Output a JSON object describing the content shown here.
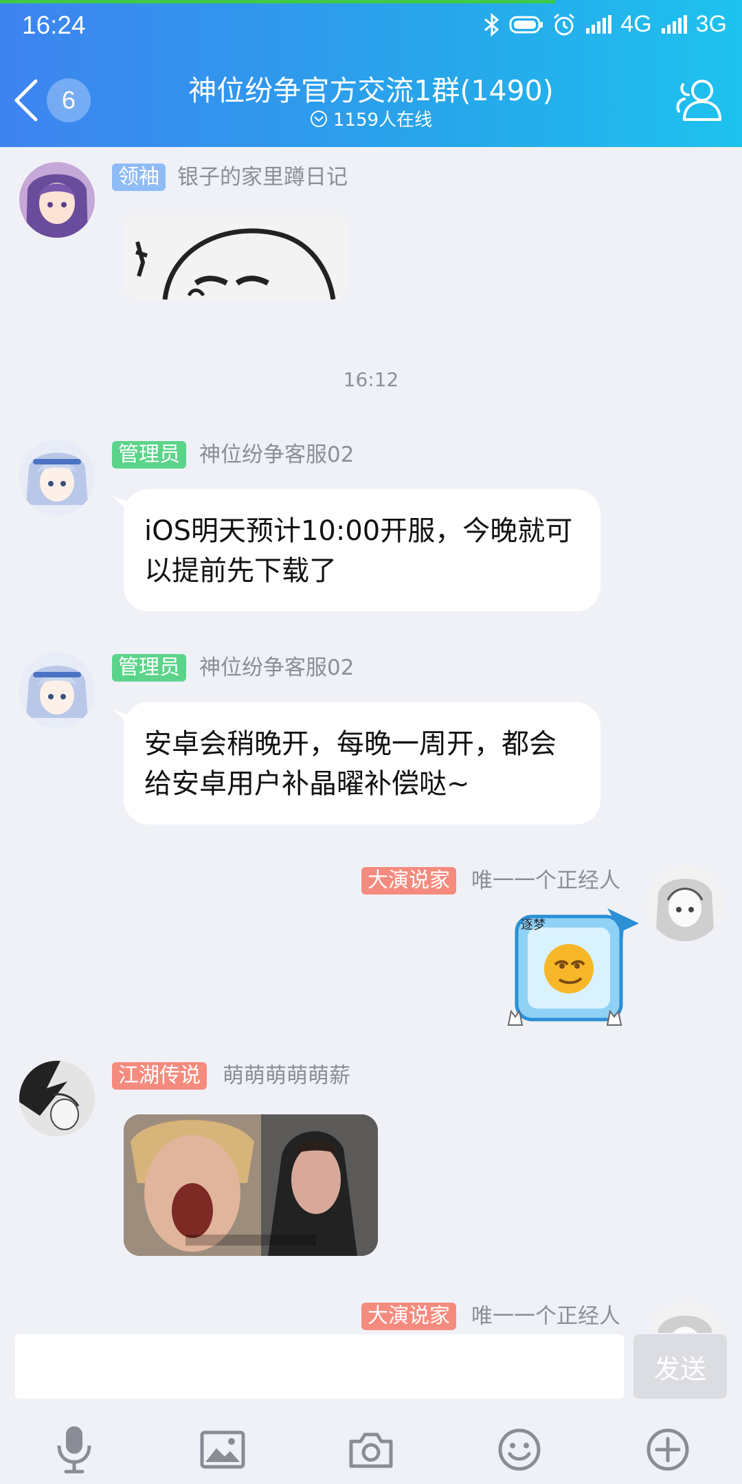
{
  "status_bar": {
    "time": "16:24",
    "network1": "4G",
    "network2": "3G",
    "icons": [
      "bluetooth-icon",
      "battery-icon",
      "alarm-icon",
      "signal-icon",
      "signal-icon"
    ]
  },
  "header": {
    "back_badge": "6",
    "title": "神位纷争官方交流1群(1490)",
    "online_text": "1159人在线"
  },
  "messages": [
    {
      "tag": "领袖",
      "sender": "银子的家里蹲日记",
      "type": "image"
    },
    {
      "timestamp": "16:12"
    },
    {
      "tag": "管理员",
      "sender": "神位纷争客服02",
      "text": "iOS明天预计10:00开服，今晚就可以提前先下载了"
    },
    {
      "tag": "管理员",
      "sender": "神位纷争客服02",
      "text": "安卓会稍晚开，每晚一周开，都会给安卓用户补晶曜补偿哒~"
    },
    {
      "tag": "大演说家",
      "sender": "唯一一个正经人",
      "type": "sticker",
      "sticker_label": "逐梦"
    },
    {
      "tag": "江湖传说",
      "sender": "萌萌萌萌萌薪",
      "type": "image"
    },
    {
      "tag": "大演说家",
      "sender": "唯一一个正经人"
    }
  ],
  "input": {
    "placeholder": "",
    "send_label": "发送"
  },
  "toolbar": [
    "mic-icon",
    "image-icon",
    "camera-icon",
    "emoji-icon",
    "plus-icon"
  ],
  "colors": {
    "header_start": "#3e83f0",
    "header_end": "#1ec2ee",
    "tag_leader": "#8fbcf6",
    "tag_admin": "#5bd48a",
    "tag_speaker": "#f58b7e"
  }
}
